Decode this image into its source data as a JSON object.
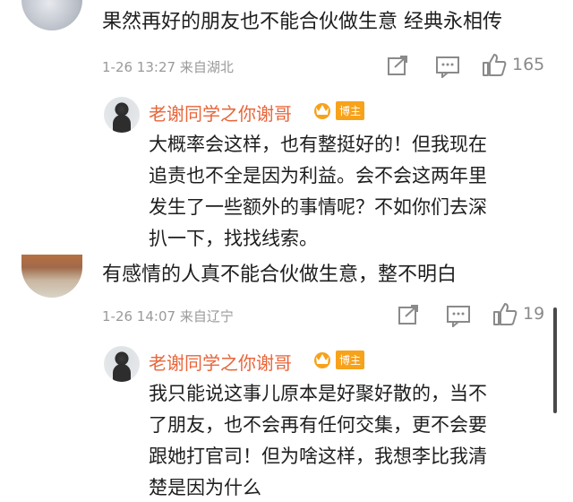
{
  "comments": [
    {
      "text": "果然再好的朋友也不能合伙做生意 经典永相传",
      "time": "1-26 13:27",
      "location": "来自湖北",
      "likes": "165",
      "reply": {
        "author": "老谢同学之你谢哥",
        "badge": "博主",
        "lines": [
          "大概率会这样，也有整挺好的！但我现在",
          "追责也不全是因为利益。会不会这两年里",
          "发生了一些额外的事情呢？不如你们去深",
          "扒一下，找找线索。"
        ]
      }
    },
    {
      "text": "有感情的人真不能合伙做生意，整不明白",
      "time": "1-26 14:07",
      "location": "来自辽宁",
      "likes": "19",
      "reply": {
        "author": "老谢同学之你谢哥",
        "badge": "博主",
        "lines": [
          "我只能说这事儿原本是好聚好散的，当不",
          "了朋友，也不会再有任何交集，更不会要",
          "跟她打官司！但为啥这样，我想李比我清",
          "楚是因为什么"
        ]
      }
    }
  ],
  "icons": {
    "share": "share-icon",
    "comment": "comment-icon",
    "like": "thumbs-up-icon",
    "crown": "crown-badge-icon"
  },
  "colors": {
    "author": "#e8653a",
    "badge": "#f7a21b",
    "meta": "#9a9a9a"
  }
}
